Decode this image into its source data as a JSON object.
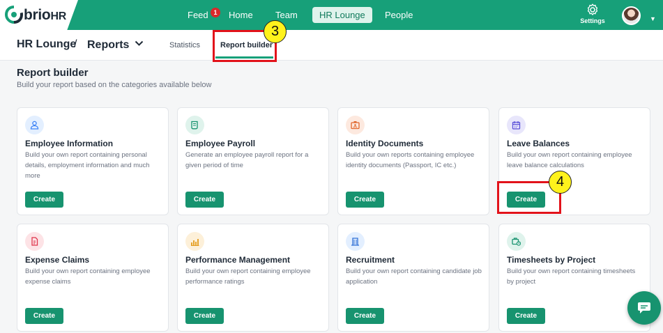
{
  "brand": {
    "name": "brio",
    "suffix": "HR"
  },
  "nav": {
    "feed": "Feed",
    "feed_badge": "1",
    "home": "Home",
    "team": "Team",
    "hr_lounge": "HR Lounge",
    "people": "People",
    "settings": "Settings"
  },
  "breadcrumb": {
    "section": "HR Lounge",
    "separator": "/",
    "page": "Reports"
  },
  "tabs": {
    "statistics": "Statistics",
    "report_builder": "Report builder"
  },
  "page": {
    "title": "Report builder",
    "subtitle": "Build your report based on the categories available below"
  },
  "cards": [
    {
      "title": "Employee Information",
      "desc": "Build your own report containing personal details, employment information and much more",
      "button": "Create"
    },
    {
      "title": "Employee Payroll",
      "desc": "Generate an employee payroll report for a given period of time",
      "button": "Create"
    },
    {
      "title": "Identity Documents",
      "desc": "Build your own reports containing employee identity documents (Passport, IC etc.)",
      "button": "Create"
    },
    {
      "title": "Leave Balances",
      "desc": "Build your own report containing employee leave balance calculations",
      "button": "Create"
    },
    {
      "title": "Expense Claims",
      "desc": "Build your own report containing employee expense claims",
      "button": "Create"
    },
    {
      "title": "Performance Management",
      "desc": "Build your own report containing employee performance ratings",
      "button": "Create"
    },
    {
      "title": "Recruitment",
      "desc": "Build your own report containing candidate job application",
      "button": "Create"
    },
    {
      "title": "Timesheets by Project",
      "desc": "Build your own report containing timesheets by project",
      "button": "Create"
    }
  ],
  "annotations": {
    "step_a": "3",
    "step_b": "4"
  },
  "colors": {
    "brand_green": "#17a079",
    "button_green": "#17936f",
    "annotation_red": "#e2121a",
    "annotation_yellow": "#fff21c"
  }
}
